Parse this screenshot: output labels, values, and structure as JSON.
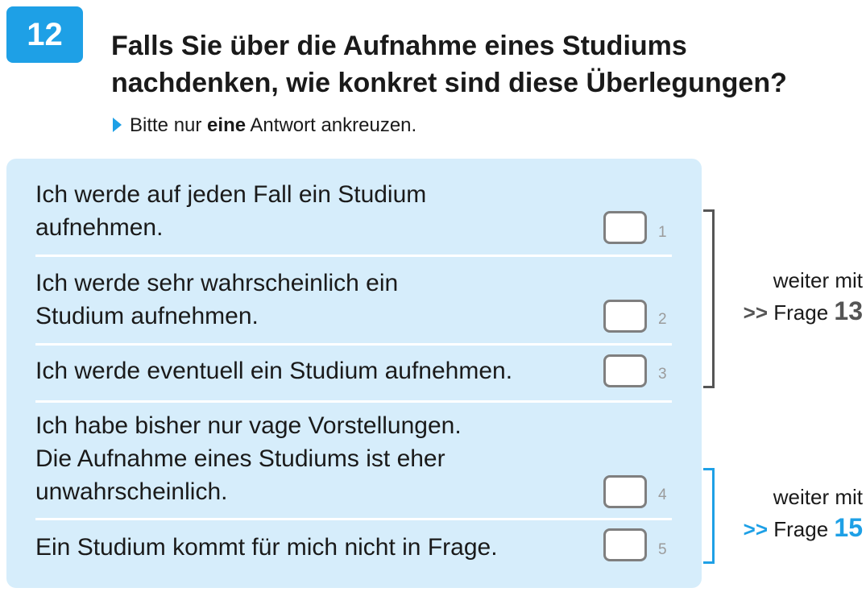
{
  "question": {
    "number": "12",
    "title_line1": "Falls Sie über die Aufnahme eines Studiums",
    "title_line2": "nachdenken, wie konkret sind diese Überlegungen?",
    "instruction_pre": "Bitte nur ",
    "instruction_bold": "eine",
    "instruction_post": " Antwort ankreuzen."
  },
  "options": [
    {
      "line1": "Ich werde auf jeden Fall ein Studium",
      "line2": "aufnehmen.",
      "code": "1",
      "checked": false
    },
    {
      "line1": "Ich werde sehr wahrscheinlich ein",
      "line2": "Studium aufnehmen.",
      "code": "2",
      "checked": false
    },
    {
      "line1": "Ich werde eventuell ein Studium aufnehmen.",
      "code": "3",
      "checked": false
    },
    {
      "line1": "Ich habe bisher nur vage Vorstellungen.",
      "line2": "Die Aufnahme eines Studiums ist eher",
      "line3": "unwahrscheinlich.",
      "code": "4",
      "checked": false
    },
    {
      "line1": "Ein Studium kommt für mich nicht in Frage.",
      "code": "5",
      "checked": false
    }
  ],
  "routing": [
    {
      "text1": "weiter mit",
      "arrow": ">>",
      "text2": "Frage",
      "target": "13"
    },
    {
      "text1": "weiter mit",
      "arrow": ">>",
      "text2": "Frage",
      "target": "15"
    }
  ],
  "colors": {
    "accent": "#1ea0e6",
    "panel": "#d6edfb",
    "checkbox_border": "#7f7f7f",
    "bracket": "#555555"
  }
}
